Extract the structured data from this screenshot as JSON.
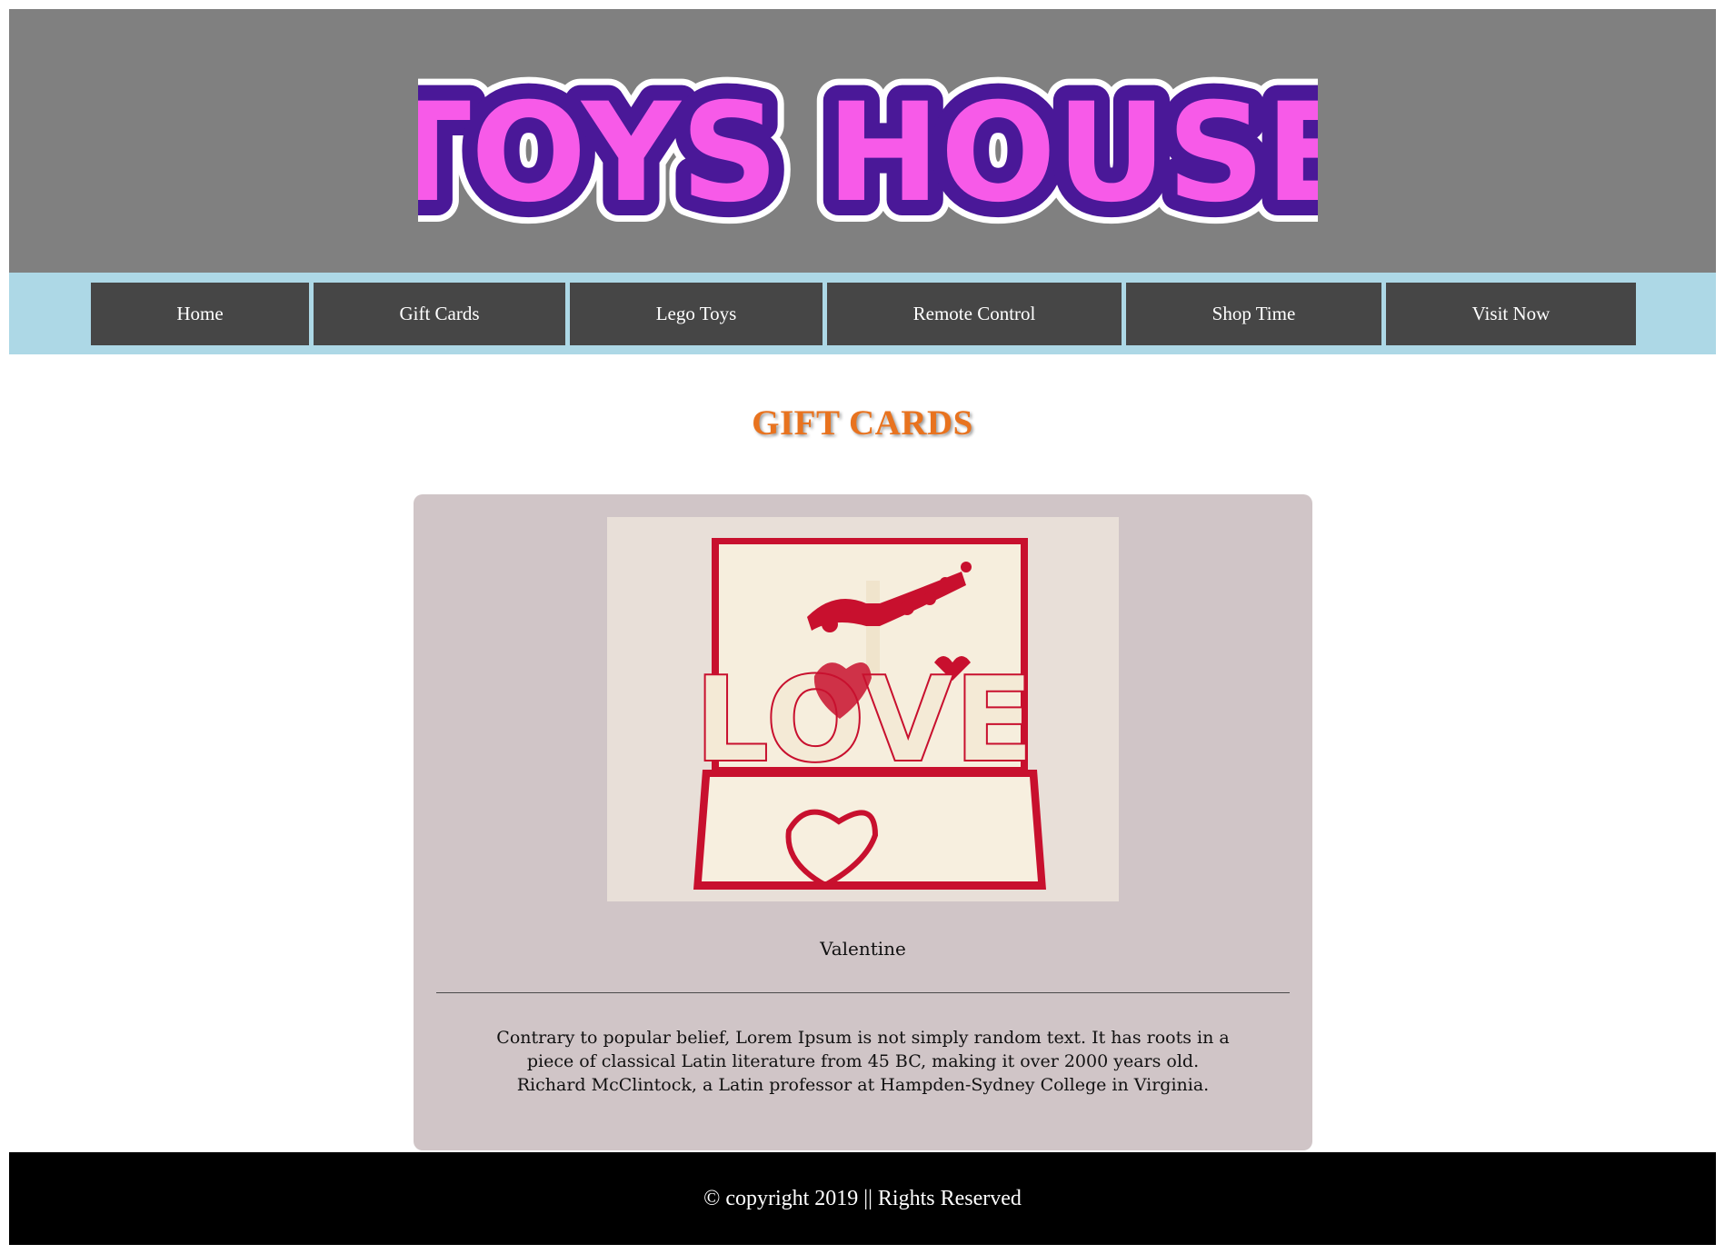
{
  "header": {
    "logo_text": "TOYS HOUSE",
    "logo_colors": {
      "fill": "#f75ae8",
      "outline": "#4a1898",
      "border": "#ffffff"
    },
    "background": "#808080"
  },
  "nav": {
    "background": "#add8e6",
    "items": [
      {
        "label": "Home"
      },
      {
        "label": "Gift Cards"
      },
      {
        "label": "Lego Toys"
      },
      {
        "label": "Remote Control"
      },
      {
        "label": "Shop Time"
      },
      {
        "label": "Visit Now"
      }
    ]
  },
  "main": {
    "title": "GIFT CARDS",
    "title_color": "#e8731f",
    "card": {
      "name": "Valentine",
      "image_text": "LOVE",
      "description": "Contrary to popular belief, Lorem Ipsum is not simply random text. It has roots in a piece of classical Latin literature from 45 BC, making it over 2000 years old. Richard McClintock, a Latin professor at Hampden-Sydney College in Virginia.",
      "background": "#d0c5c7"
    }
  },
  "footer": {
    "text": "© copyright 2019 || Rights Reserved"
  }
}
